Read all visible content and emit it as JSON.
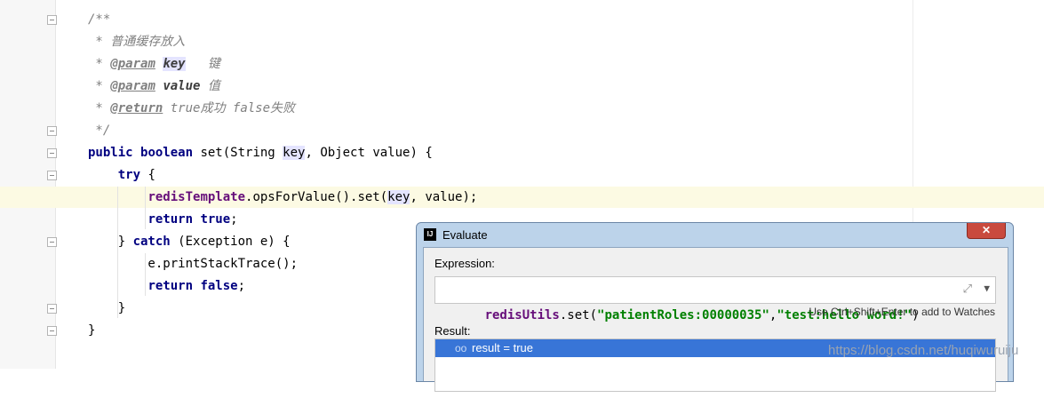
{
  "editor": {
    "lines": [
      [
        {
          "t": "/**",
          "c": "cm"
        }
      ],
      [
        {
          "t": " * 普通缓存放入",
          "c": "cm"
        }
      ],
      [
        {
          "t": " * ",
          "c": "cm"
        },
        {
          "t": "@param",
          "c": "tag"
        },
        {
          "t": " ",
          "c": "cm"
        },
        {
          "t": "key",
          "c": "pn hl"
        },
        {
          "t": "   键",
          "c": "cm"
        }
      ],
      [
        {
          "t": " * ",
          "c": "cm"
        },
        {
          "t": "@param",
          "c": "tag"
        },
        {
          "t": " ",
          "c": "cm"
        },
        {
          "t": "value",
          "c": "pn"
        },
        {
          "t": " 值",
          "c": "cm"
        }
      ],
      [
        {
          "t": " * ",
          "c": "cm"
        },
        {
          "t": "@return",
          "c": "tag"
        },
        {
          "t": " true成功 false失败",
          "c": "cm"
        }
      ],
      [
        {
          "t": " */",
          "c": "cm"
        }
      ],
      [
        {
          "t": "public ",
          "c": "kw"
        },
        {
          "t": "boolean ",
          "c": "kw"
        },
        {
          "t": "set(String "
        },
        {
          "t": "key",
          "c": "hl"
        },
        {
          "t": ", Object value) {"
        }
      ],
      [
        {
          "t": "    "
        },
        {
          "t": "try ",
          "c": "kw"
        },
        {
          "t": "{"
        }
      ],
      [
        {
          "t": "        "
        },
        {
          "t": "redisTemplate",
          "c": "fld"
        },
        {
          "t": ".opsForValue().set("
        },
        {
          "t": "key",
          "c": "hl"
        },
        {
          "t": ", value);"
        }
      ],
      [
        {
          "t": "        "
        },
        {
          "t": "return ",
          "c": "kw"
        },
        {
          "t": "true",
          "c": "kw"
        },
        {
          "t": ";"
        }
      ],
      [
        {
          "t": "    } "
        },
        {
          "t": "catch ",
          "c": "kw"
        },
        {
          "t": "(Exception e) {"
        }
      ],
      [
        {
          "t": "        e.printStackTrace();"
        }
      ],
      [
        {
          "t": "        "
        },
        {
          "t": "return ",
          "c": "kw"
        },
        {
          "t": "false",
          "c": "kw"
        },
        {
          "t": ";"
        }
      ],
      [
        {
          "t": "    }"
        }
      ],
      [
        {
          "t": "}"
        }
      ]
    ]
  },
  "dialog": {
    "title": "Evaluate",
    "app_icon": "IJ",
    "close_symbol": "✕",
    "expression_label": "Expression:",
    "expression_parts": [
      {
        "t": "redisUtils",
        "c": "fld"
      },
      {
        "t": ".set("
      },
      {
        "t": "\"patientRoles:00000035\"",
        "c": "str"
      },
      {
        "t": ","
      },
      {
        "t": "\"test:hello word!\"",
        "c": "str"
      },
      {
        "t": ")"
      }
    ],
    "expand_icon": "expand-icon",
    "dropdown_icon": "chevron-down-icon",
    "hint": "Use Ctrl+Shift+Enter to add to Watches",
    "result_label": "Result:",
    "result_icon": "glasses-icon",
    "result_text": "result = true"
  },
  "watermark": "https://blog.csdn.net/huqiwuruiju"
}
